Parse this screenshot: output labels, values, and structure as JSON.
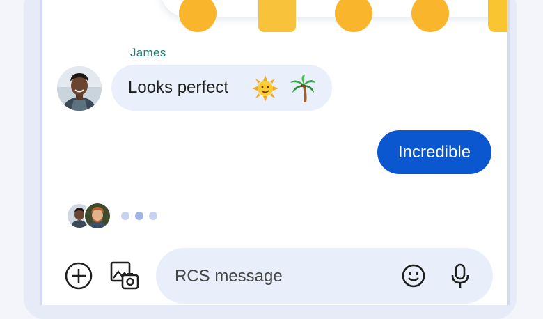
{
  "conversation": {
    "incoming": {
      "sender": "James",
      "text": "Looks perfect",
      "emojis": [
        "sun-with-face",
        "palm-tree"
      ]
    },
    "outgoing": {
      "text": "Incredible"
    },
    "typing_indicator": {
      "participants": [
        "participant-1",
        "participant-2"
      ],
      "dots": 3
    }
  },
  "compose": {
    "placeholder": "RCS message",
    "icons": [
      "add-circle-icon",
      "gallery-camera-icon",
      "emoji-icon",
      "mic-icon"
    ]
  },
  "colors": {
    "accent": "#0b57d0",
    "incoming_bubble": "#eaf0fb",
    "sender_name": "#1a7e78",
    "compose_field": "#e9effa"
  }
}
